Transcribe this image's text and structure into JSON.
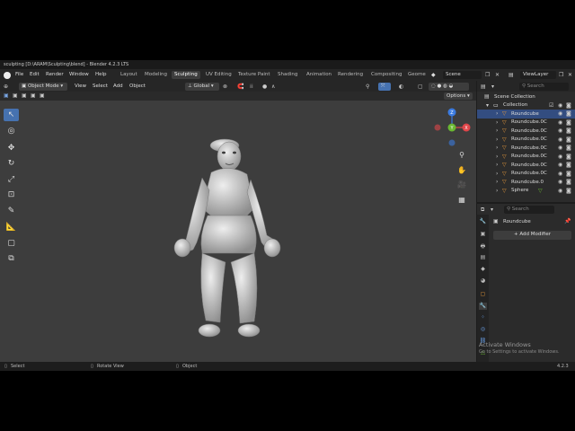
{
  "window": {
    "title": "sculpting [D:\\ARAM\\Sculpting\\blend] - Blender 4.2.3 LTS"
  },
  "menu": [
    "File",
    "Edit",
    "Render",
    "Window",
    "Help"
  ],
  "workspaces": [
    "Layout",
    "Modeling",
    "Sculpting",
    "UV Editing",
    "Texture Paint",
    "Shading",
    "Animation",
    "Rendering",
    "Compositing",
    "Geome"
  ],
  "active_workspace": "Sculpting",
  "scene": {
    "label": "Scene",
    "view_layer": "ViewLayer"
  },
  "viewport_header": {
    "mode": "Object Mode",
    "menus": [
      "View",
      "Select",
      "Add",
      "Object"
    ],
    "orientation": "Global",
    "options": "Options"
  },
  "gizmo": {
    "z": "Z",
    "y": "Y",
    "x": "X"
  },
  "outliner": {
    "search_placeholder": "Search",
    "scene_collection": "Scene Collection",
    "collection": "Collection",
    "objects": [
      "Roundcube",
      "Roundcube.0C",
      "Roundcube.0C",
      "Roundcube.0C",
      "Roundcube.0C",
      "Roundcube.0C",
      "Roundcube.0C",
      "Roundcube.0C",
      "Roundcube.0",
      "Sphere"
    ]
  },
  "properties": {
    "search_placeholder": "Search",
    "object_name": "Roundcube",
    "add_modifier": "Add Modifier"
  },
  "status": {
    "select": "Select",
    "rotate": "Rotate View",
    "object": "Object",
    "version": "4.2.3"
  },
  "watermark": {
    "title": "Activate Windows",
    "subtitle": "Go to Settings to activate Windows."
  },
  "colors": {
    "accent": "#4672b0",
    "viewport": "#3d3d3d",
    "x_axis": "#e0464a",
    "y_axis": "#6ab832",
    "z_axis": "#3b7be0"
  }
}
